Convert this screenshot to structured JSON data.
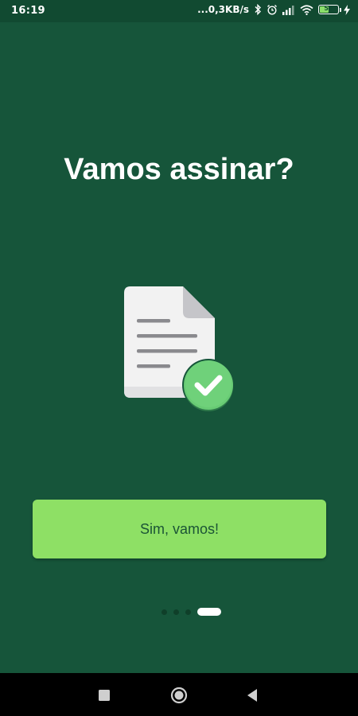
{
  "status_bar": {
    "time": "16:19",
    "network_speed": "...0,3KB/s",
    "battery_level": "51",
    "battery_fraction": 0.51
  },
  "onboarding": {
    "title": "Vamos assinar?",
    "cta_label": "Sim, vamos!",
    "pager": {
      "total_pages": 4,
      "active_index": 3
    }
  },
  "colors": {
    "background": "#16553a",
    "status_bar": "#114a31",
    "button": "#8ee065",
    "button_text": "#1b5436",
    "check_badge": "#6fd17a"
  },
  "icons": {
    "illustration": "signed-document-icon",
    "status": [
      "bluetooth-icon",
      "alarm-icon",
      "signal-icon",
      "wifi-icon",
      "battery-icon",
      "charging-icon"
    ],
    "nav": [
      "recents-square-icon",
      "home-circle-icon",
      "back-triangle-icon"
    ]
  }
}
